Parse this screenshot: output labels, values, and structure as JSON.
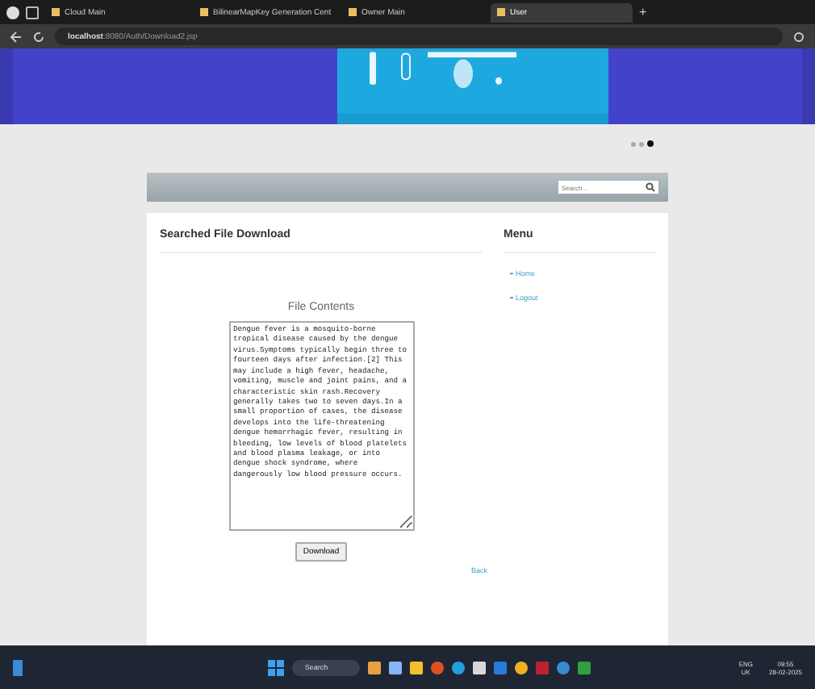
{
  "browser": {
    "tabs": [
      {
        "label": "Cloud Main",
        "selected": false
      },
      {
        "label": "BilinearMapKey Generation Cent",
        "selected": false
      },
      {
        "label": "Owner Main",
        "selected": false
      },
      {
        "label": "User",
        "selected": true
      }
    ],
    "new_tab": "+",
    "url_host": "localhost",
    "url_path": ":8080/Auth/Download2.jsp"
  },
  "slider_dots": [
    {
      "selected": false
    },
    {
      "selected": false
    },
    {
      "selected": true
    }
  ],
  "search": {
    "placeholder": "Search..."
  },
  "main": {
    "title": "Searched File Download",
    "subtitle": "File Contents",
    "content": "Dengue fever is a mosquito-borne tropical disease caused by the dengue virus.Symptoms typically begin three to fourteen days after infection.[2] This may include a high fever, headache, vomiting, muscle and joint pains, and a characteristic skin rash.Recovery generally takes two to seven days.In a small proportion of cases, the disease develops into the life-threatening dengue hemorrhagic fever, resulting in bleeding, low levels of blood platelets and blood plasma leakage, or into dengue shock syndrome, where dangerously low blood pressure occurs.",
    "button": "Download",
    "back": "Back"
  },
  "menu": {
    "title": "Menu",
    "items": [
      "Home",
      "Logout"
    ]
  },
  "taskbar": {
    "search": "Search",
    "lang": "ENG",
    "region": "UK",
    "time": "09:55",
    "date": "28-02-2025"
  }
}
